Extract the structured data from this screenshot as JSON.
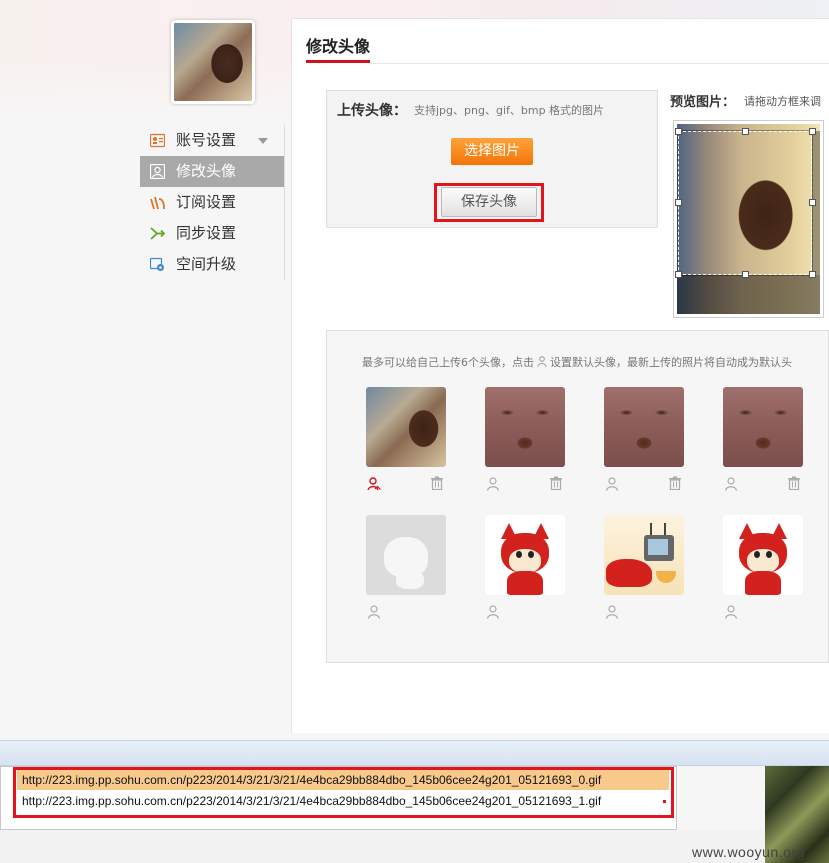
{
  "sidebar": {
    "items": [
      {
        "label": "账号设置",
        "icon": "account-card-icon",
        "active": false,
        "has_caret": true
      },
      {
        "label": "修改头像",
        "icon": "user-avatar-icon",
        "active": true,
        "has_caret": false
      },
      {
        "label": "订阅设置",
        "icon": "subscribe-icon",
        "active": false,
        "has_caret": false
      },
      {
        "label": "同步设置",
        "icon": "sync-arrow-icon",
        "active": false,
        "has_caret": false
      },
      {
        "label": "空间升级",
        "icon": "gear-upgrade-icon",
        "active": false,
        "has_caret": false
      }
    ]
  },
  "tab": {
    "title": "修改头像"
  },
  "upload": {
    "label": "上传头像：",
    "hint": "支持jpg、png、gif、bmp 格式的图片",
    "choose_label": "选择图片",
    "save_label": "保存头像"
  },
  "preview": {
    "label": "预览图片：",
    "hint": "请拖动方框来调"
  },
  "gallery": {
    "hint_before": "最多可以给自己上传6个头像，点击",
    "hint_after": "设置默认头像，最新上传的照片将自动成为默认头",
    "rows": [
      [
        {
          "kind": "photo-collage",
          "default": true,
          "deletable": true
        },
        {
          "kind": "photo-closeup",
          "default": false,
          "deletable": true
        },
        {
          "kind": "photo-closeup",
          "default": false,
          "deletable": true
        },
        {
          "kind": "photo-closeup",
          "default": false,
          "deletable": true
        }
      ],
      [
        {
          "kind": "fox-gray",
          "default": false,
          "deletable": false
        },
        {
          "kind": "fox-red",
          "default": false,
          "deletable": false
        },
        {
          "kind": "fox-tv",
          "default": false,
          "deletable": false
        },
        {
          "kind": "fox-red-smile",
          "default": false,
          "deletable": false
        }
      ]
    ]
  },
  "url_list": {
    "items": [
      "http://223.img.pp.sohu.com.cn/p223/2014/3/21/3/21/4e4bca29bb884dbo_145b06cee24g201_05121693_0.gif",
      "http://223.img.pp.sohu.com.cn/p223/2014/3/21/3/21/4e4bca29bb884dbo_145b06cee24g201_05121693_1.gif"
    ]
  },
  "watermark": "www.wooyun.org",
  "colors": {
    "accent_red": "#d0111b",
    "highlight_outline": "#e0151d",
    "choose_button": "#f27408",
    "active_sidebar": "#a9a9a9",
    "url_highlight": "#f7c98a"
  }
}
